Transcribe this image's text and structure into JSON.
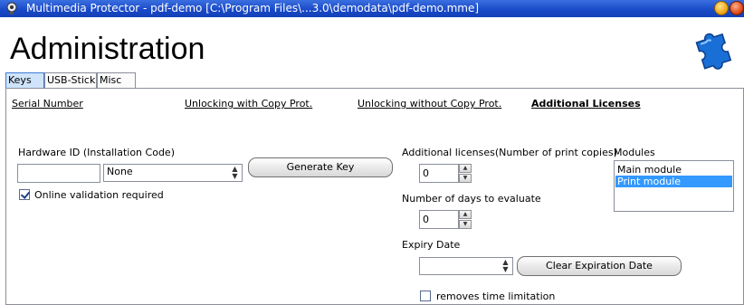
{
  "window": {
    "title": "Multimedia Protector - pdf-demo [C:\\Program Files\\...3.0\\demodata\\pdf-demo.mme]"
  },
  "page": {
    "title": "Administration"
  },
  "tabs": [
    "Keys",
    "USB-Stick",
    "Misc"
  ],
  "subnav": [
    "Serial Number",
    "Unlocking with Copy Prot.",
    "Unlocking without Copy Prot.",
    "Additional Licenses"
  ],
  "hardware": {
    "label": "Hardware ID (Installation Code)",
    "value": "",
    "select_value": "None",
    "generate_label": "Generate Key",
    "online_validation_label": "Online validation required",
    "online_validation_checked": true
  },
  "licenses": {
    "label": "Additional licenses(Number of print copies)",
    "value": "0",
    "days_label": "Number of days to evaluate",
    "days_value": "0",
    "expiry_label": "Expiry Date",
    "expiry_value": "",
    "clear_label": "Clear Expiration Date",
    "removes_label": "removes time limitation",
    "removes_checked": false
  },
  "modules": {
    "label": "Modules",
    "items": [
      "Main module",
      "Print module"
    ],
    "selected": "Print module"
  },
  "colors": {
    "titlebar": "#1848c6",
    "tab_active": "#cfe4fa",
    "selection": "#3399ff"
  },
  "icons": [
    "app-icon",
    "puzzle-icon",
    "minimize-icon",
    "close-icon",
    "combo-arrow-icon",
    "spin-up-icon",
    "spin-down-icon",
    "check-icon"
  ]
}
